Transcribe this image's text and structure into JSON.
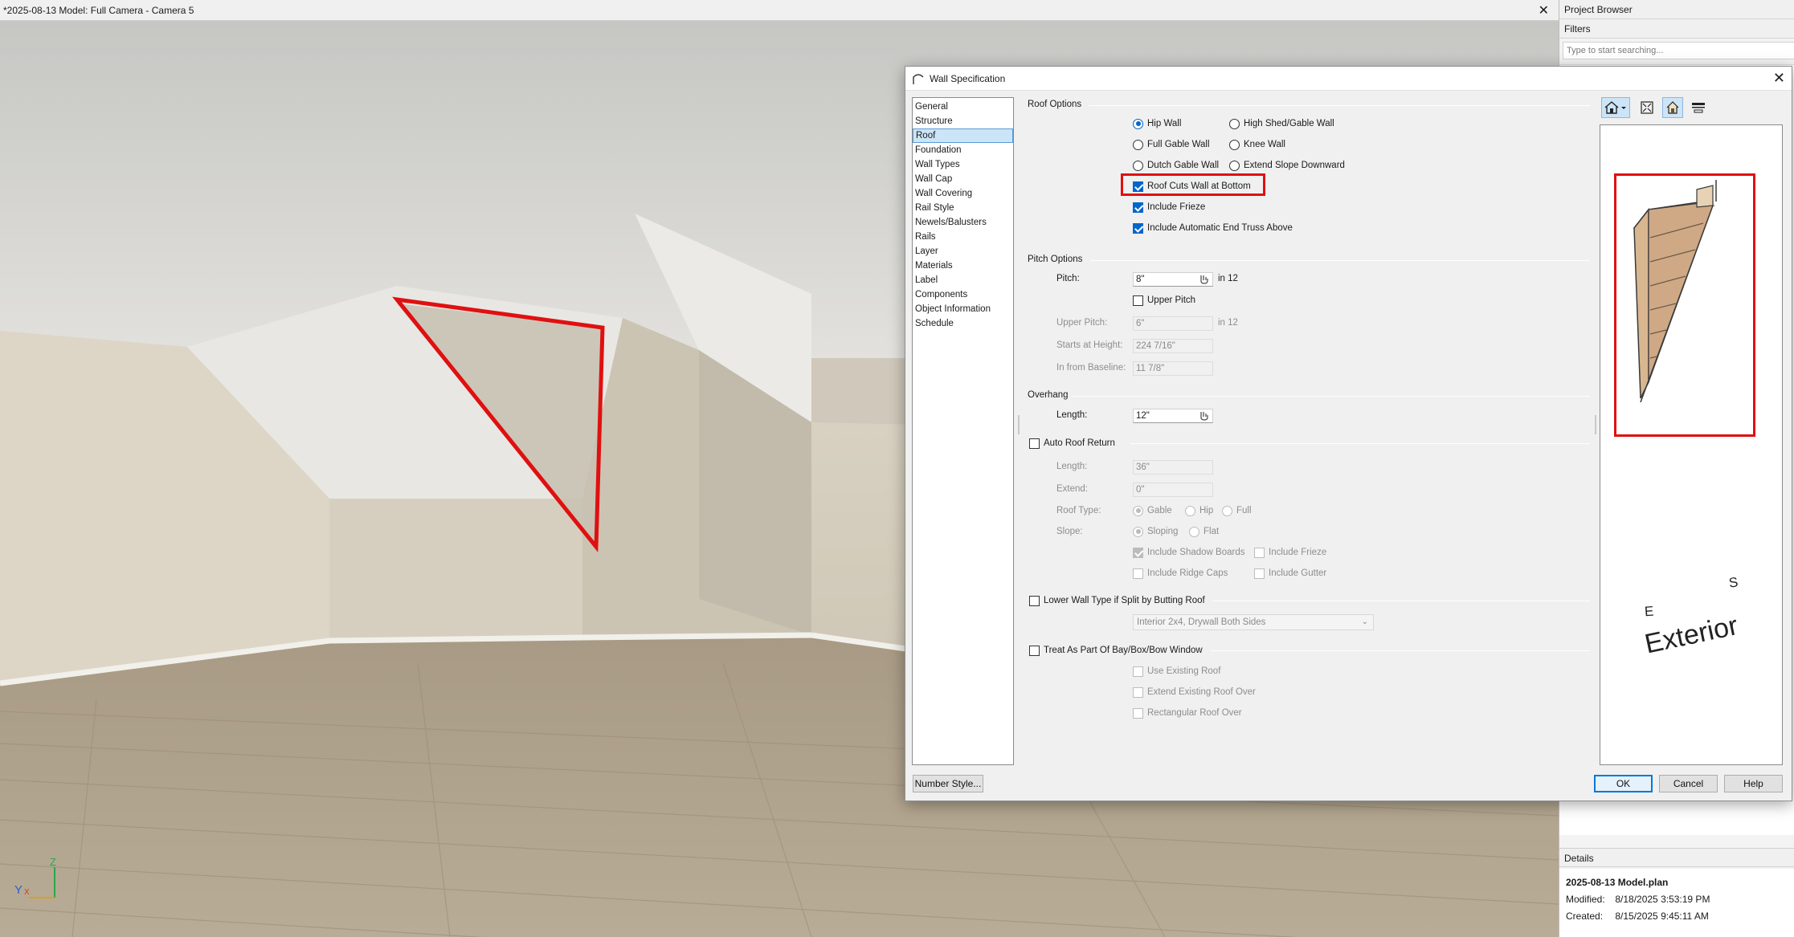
{
  "window": {
    "title": "*2025-08-13 Model: Full Camera - Camera 5",
    "close_glyph": "✕",
    "axis": {
      "z": "Z",
      "y": "Y",
      "x": "X"
    }
  },
  "project_browser": {
    "title": "Project Browser",
    "filters_label": "Filters",
    "search_placeholder": "Type to start searching...",
    "details_title": "Details",
    "details": {
      "file_name": "2025-08-13 Model.plan",
      "modified_label": "Modified:",
      "modified_value": "8/18/2025 3:53:19 PM",
      "created_label": "Created:",
      "created_value": "8/15/2025 9:45:11 AM"
    }
  },
  "dialog": {
    "title": "Wall Specification",
    "close_glyph": "✕",
    "nav_items": [
      "General",
      "Structure",
      "Roof",
      "Foundation",
      "Wall Types",
      "Wall Cap",
      "Wall Covering",
      "Rail Style",
      "Newels/Balusters",
      "Rails",
      "Layer",
      "Materials",
      "Label",
      "Components",
      "Object Information",
      "Schedule"
    ],
    "nav_selected": "Roof",
    "buttons": {
      "number_style": "Number Style...",
      "ok": "OK",
      "cancel": "Cancel",
      "help": "Help"
    },
    "roof_options": {
      "label": "Roof Options",
      "hip_wall": "Hip Wall",
      "high_shed_gable_wall": "High Shed/Gable Wall",
      "full_gable_wall": "Full Gable Wall",
      "knee_wall": "Knee Wall",
      "dutch_gable_wall": "Dutch Gable Wall",
      "extend_slope_downward": "Extend Slope Downward",
      "roof_cuts_wall_at_bottom": "Roof Cuts Wall at Bottom",
      "include_frieze": "Include Frieze",
      "include_auto_end_truss": "Include Automatic End Truss Above",
      "selected_radio": "Hip Wall"
    },
    "pitch_options": {
      "label": "Pitch Options",
      "pitch_label": "Pitch:",
      "pitch_value": "8\"",
      "pitch_unit": "in 12",
      "upper_pitch_checkbox": "Upper Pitch",
      "upper_pitch_label": "Upper Pitch:",
      "upper_pitch_value": "6\"",
      "upper_pitch_unit": "in 12",
      "starts_at_height_label": "Starts at Height:",
      "starts_at_height_value": "224 7/16\"",
      "in_from_baseline_label": "In from Baseline:",
      "in_from_baseline_value": "11 7/8\""
    },
    "overhang": {
      "label": "Overhang",
      "length_label": "Length:",
      "length_value": "12\""
    },
    "auto_roof_return": {
      "label": "Auto Roof Return",
      "length_label": "Length:",
      "length_value": "36\"",
      "extend_label": "Extend:",
      "extend_value": "0\"",
      "roof_type_label": "Roof Type:",
      "gable": "Gable",
      "hip": "Hip",
      "full": "Full",
      "slope_label": "Slope:",
      "sloping": "Sloping",
      "flat": "Flat",
      "include_shadow_boards": "Include Shadow Boards",
      "include_frieze": "Include Frieze",
      "include_ridge_caps": "Include Ridge Caps",
      "include_gutter": "Include Gutter"
    },
    "lower_wall_type": {
      "label": "Lower Wall Type if Split by Butting Roof",
      "select_value": "Interior 2x4, Drywall Both Sides"
    },
    "bay_window": {
      "label": "Treat As Part Of Bay/Box/Bow Window",
      "use_existing_roof": "Use Existing Roof",
      "extend_existing_roof_over": "Extend Existing Roof Over",
      "rectangular_roof_over": "Rectangular Roof Over"
    },
    "preview": {
      "side_label": "Exterior",
      "compass_e": "E",
      "compass_s": "S"
    }
  },
  "colors": {
    "highlight": "#e01010",
    "selected_bg": "#cce4f7",
    "accent": "#0066cc"
  }
}
